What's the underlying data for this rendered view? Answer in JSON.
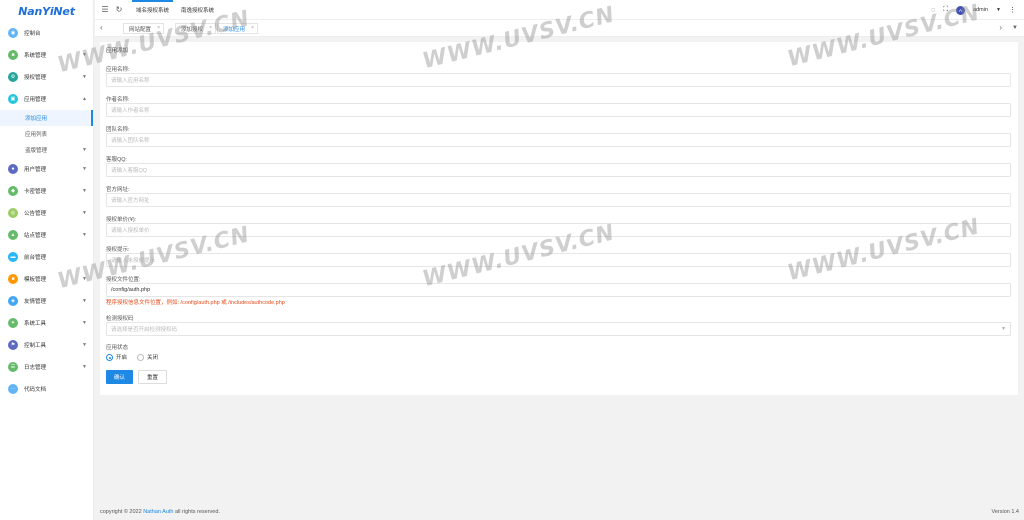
{
  "sidebar": {
    "logo": "NanYiNet",
    "items": [
      {
        "label": "控制台",
        "icon": "dashboard-icon",
        "color": "#64b5f6"
      },
      {
        "label": "系统管理",
        "icon": "system-icon",
        "color": "#66bb6a"
      },
      {
        "label": "授权管理",
        "icon": "auth-icon",
        "color": "#26a69a"
      },
      {
        "label": "应用管理",
        "icon": "app-icon",
        "color": "#26c6da"
      },
      {
        "label": "用户管理",
        "icon": "user-icon",
        "color": "#5c6bc0"
      },
      {
        "label": "卡密管理",
        "icon": "card-icon",
        "color": "#66bb6a"
      },
      {
        "label": "公告管理",
        "icon": "notice-icon",
        "color": "#9ccc65"
      },
      {
        "label": "站点管理",
        "icon": "site-icon",
        "color": "#66bb6a"
      },
      {
        "label": "前台管理",
        "icon": "frontend-icon",
        "color": "#29b6f6"
      },
      {
        "label": "模板管理",
        "icon": "template-icon",
        "color": "#ff9800"
      },
      {
        "label": "友情管理",
        "icon": "friend-icon",
        "color": "#42a5f5"
      },
      {
        "label": "系统工具",
        "icon": "tool-icon",
        "color": "#66bb6a"
      },
      {
        "label": "控制工具",
        "icon": "control-icon",
        "color": "#5c6bc0"
      },
      {
        "label": "日志管理",
        "icon": "log-icon",
        "color": "#66bb6a"
      },
      {
        "label": "代码文档",
        "icon": "doc-icon",
        "color": "#64b5f6"
      }
    ],
    "subitems": [
      {
        "label": "添加应用"
      },
      {
        "label": "应用列表"
      },
      {
        "label": "盗版管理"
      }
    ]
  },
  "topbar": {
    "tab1": "域名授权系统",
    "tab2": "南逸授权系统",
    "user": "admin"
  },
  "tabs": {
    "t1": "网站配置",
    "t2": "添加授权",
    "t3": "添加应用"
  },
  "form": {
    "title": "应用添加",
    "fields": [
      {
        "label": "应用名称:",
        "placeholder": "请输入应用名称"
      },
      {
        "label": "作者名称:",
        "placeholder": "请输入作者名称"
      },
      {
        "label": "团队名称:",
        "placeholder": "请输入团队名称"
      },
      {
        "label": "客服QQ:",
        "placeholder": "请输入客服QQ"
      },
      {
        "label": "官方网址:",
        "placeholder": "请输入官方网址"
      },
      {
        "label": "授权单价(¥):",
        "placeholder": "请输入授权单价"
      },
      {
        "label": "授权提示:",
        "placeholder": "请输入未授权提示"
      },
      {
        "label": "授权文件位置:",
        "value": "/config/auth.php"
      }
    ],
    "file_hint": "程序授权信息文件位置，例如: /config/auth.php 或 /includes/authcode.php",
    "detect": {
      "label": "检测授权码",
      "placeholder": "请选择是否开启检测授权码"
    },
    "status": {
      "label": "应用状态",
      "on": "开启",
      "off": "关闭"
    },
    "confirm": "确认",
    "reset": "重置"
  },
  "footer": {
    "prefix": "copyright © 2022",
    "brand": "Nathan Auth",
    "suffix": "all rights reserved.",
    "version": "Version 1.4"
  },
  "watermark": "WWW.UVSV.CN"
}
